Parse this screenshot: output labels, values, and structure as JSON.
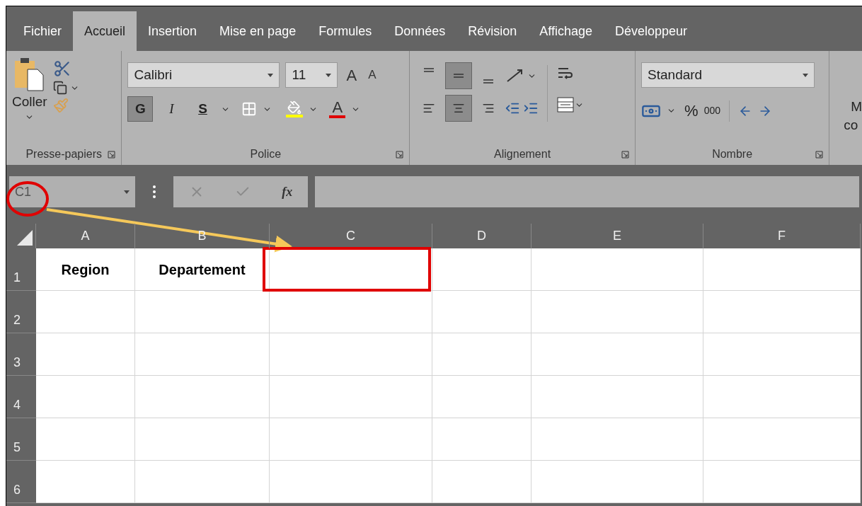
{
  "tabs": [
    {
      "label": "Fichier",
      "selected": false
    },
    {
      "label": "Accueil",
      "selected": true
    },
    {
      "label": "Insertion",
      "selected": false
    },
    {
      "label": "Mise en page",
      "selected": false
    },
    {
      "label": "Formules",
      "selected": false
    },
    {
      "label": "Données",
      "selected": false
    },
    {
      "label": "Révision",
      "selected": false
    },
    {
      "label": "Affichage",
      "selected": false
    },
    {
      "label": "Développeur",
      "selected": false
    }
  ],
  "ribbon": {
    "clipboard": {
      "paste_label": "Coller",
      "group_label": "Presse-papiers"
    },
    "font": {
      "font_name": "Calibri",
      "font_size": "11",
      "grow_label": "A",
      "shrink_label": "A",
      "styles": [
        {
          "label": "G",
          "kind": "bold",
          "selected": true
        },
        {
          "label": "I",
          "kind": "italic",
          "selected": false
        },
        {
          "label": "S",
          "kind": "underline",
          "selected": false
        }
      ],
      "font_color_label": "A",
      "group_label": "Police"
    },
    "alignment": {
      "vertical": [
        {
          "kind": "top",
          "selected": false
        },
        {
          "kind": "middle",
          "selected": true
        },
        {
          "kind": "bottom",
          "selected": false
        }
      ],
      "horizontal": [
        {
          "kind": "left",
          "selected": false
        },
        {
          "kind": "center",
          "selected": true
        },
        {
          "kind": "right",
          "selected": false
        }
      ],
      "group_label": "Alignement"
    },
    "number": {
      "format": "Standard",
      "percent_label": "%",
      "thousands_label": "000",
      "group_label": "Nombre"
    },
    "cut_group": {
      "lines": [
        "M",
        "co"
      ]
    }
  },
  "formula_bar": {
    "name_box": "C1",
    "fx_label": "fx"
  },
  "sheet": {
    "columns": [
      "A",
      "B",
      "C",
      "D",
      "E",
      "F"
    ],
    "rows": [
      {
        "header": "1",
        "cells": [
          "Region",
          "Departement"
        ]
      },
      {
        "header": "2"
      },
      {
        "header": "3"
      },
      {
        "header": "4"
      },
      {
        "header": "5"
      },
      {
        "header": "6"
      }
    ]
  },
  "annotations": [
    {
      "kind": "circle"
    },
    {
      "kind": "arrow"
    },
    {
      "kind": "frame"
    }
  ]
}
